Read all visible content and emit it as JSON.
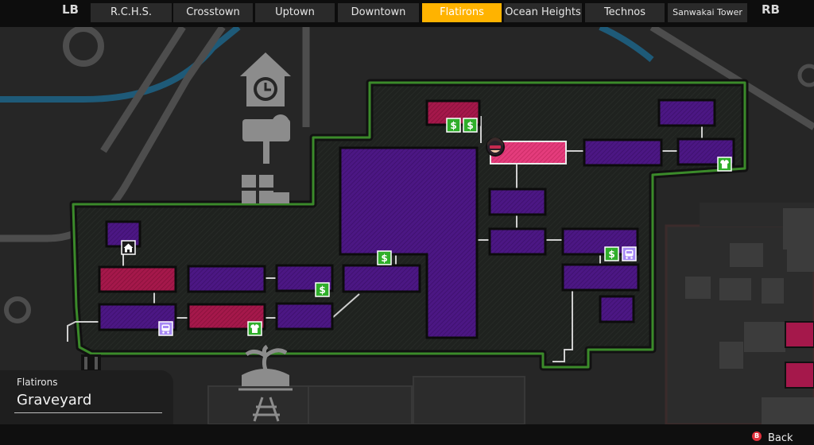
{
  "nav": {
    "lb": "LB",
    "rb": "RB",
    "tabs": [
      {
        "label": "R.C.H.S."
      },
      {
        "label": "Crosstown"
      },
      {
        "label": "Uptown"
      },
      {
        "label": "Downtown"
      },
      {
        "label": "Flatirons",
        "active": true
      },
      {
        "label": "Ocean Heights"
      },
      {
        "label": "Technos"
      },
      {
        "label": "Sanwakai Tower"
      }
    ]
  },
  "location": {
    "district": "Flatirons",
    "area": "Graveyard"
  },
  "footer": {
    "back_button_glyph": "B",
    "back_label": "Back"
  },
  "map": {
    "icons": [
      {
        "type": "dollar-icon"
      },
      {
        "type": "dollar-icon"
      },
      {
        "type": "dollar-icon"
      },
      {
        "type": "dollar-icon"
      },
      {
        "type": "dollar-icon"
      },
      {
        "type": "shirt-icon"
      },
      {
        "type": "shirt-icon"
      },
      {
        "type": "bus-icon"
      },
      {
        "type": "bus-icon"
      },
      {
        "type": "home-icon"
      },
      {
        "type": "player-marker-icon"
      }
    ],
    "landmarks": [
      {
        "type": "clock-tower-icon"
      },
      {
        "type": "tree-sign-icon"
      },
      {
        "type": "window-building-icon"
      },
      {
        "type": "palm-island-icon"
      }
    ],
    "colors": {
      "room": "#4a1580",
      "room_highlight": "#a01848",
      "room_current": "#e03a78",
      "region_fill": "#1f221f",
      "region_border": "#3b8a2a",
      "icon_green": "#2fae2a",
      "icon_purple": "#a789f5",
      "active_tab": "#ffb300"
    }
  }
}
